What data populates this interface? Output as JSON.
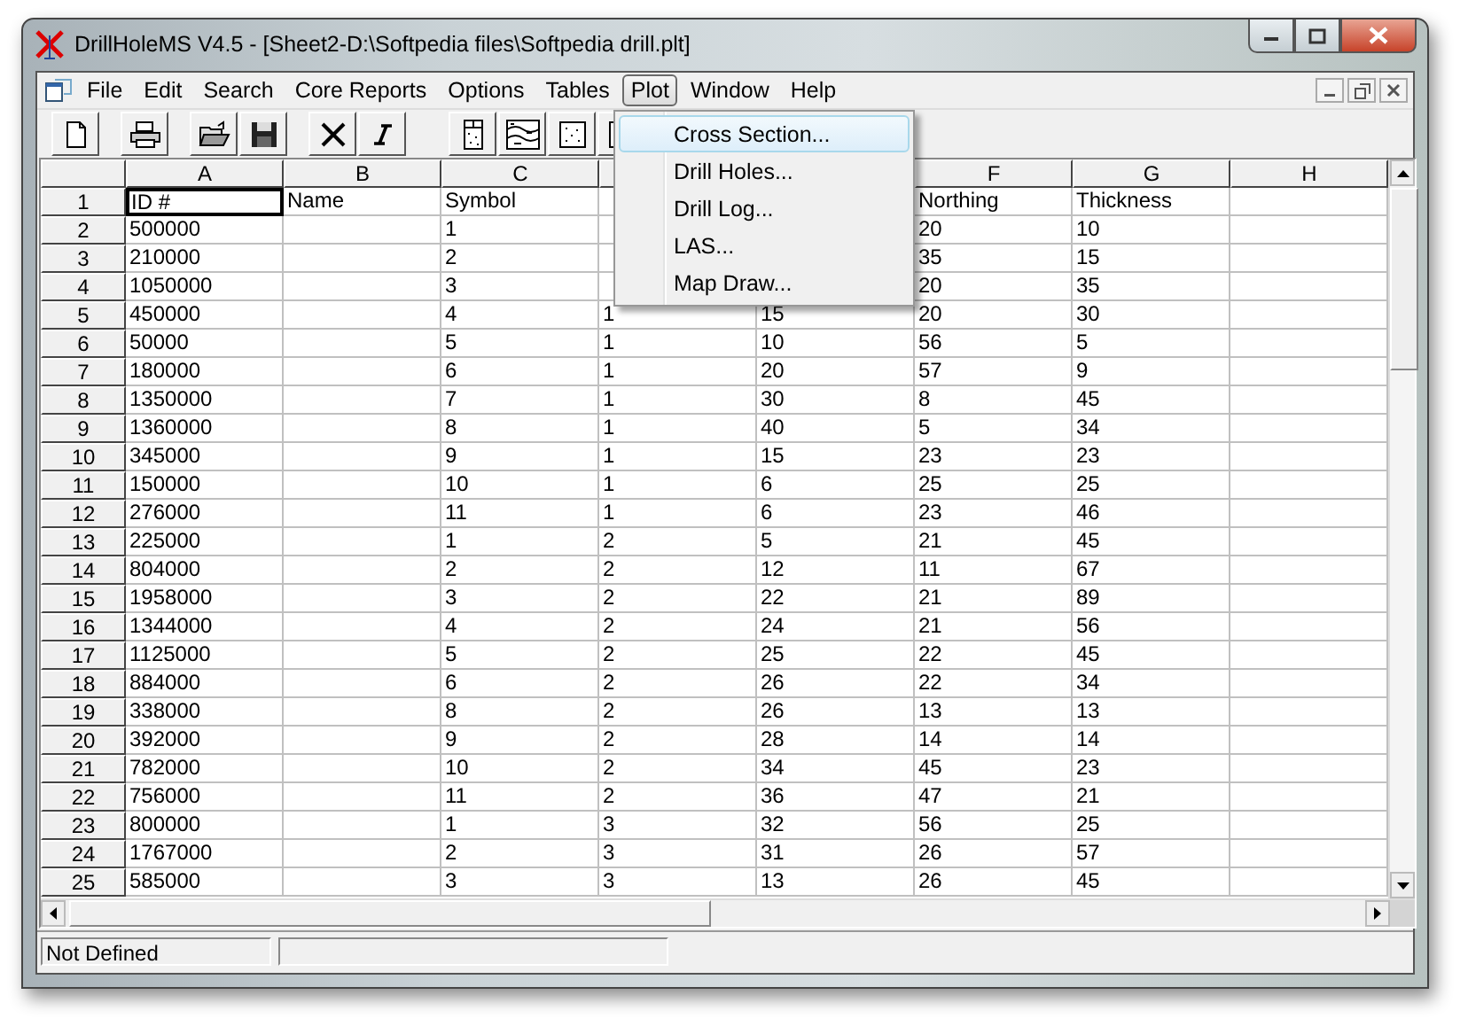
{
  "window": {
    "title": "DrillHoleMS V4.5 - [Sheet2-D:\\Softpedia files\\Softpedia drill.plt]"
  },
  "menu_bar": {
    "items": [
      {
        "label": "File",
        "selected": false
      },
      {
        "label": "Edit",
        "selected": false
      },
      {
        "label": "Search",
        "selected": false
      },
      {
        "label": "Core Reports",
        "selected": false
      },
      {
        "label": "Options",
        "selected": false
      },
      {
        "label": "Tables",
        "selected": false
      },
      {
        "label": "Plot",
        "selected": true
      },
      {
        "label": "Window",
        "selected": false
      },
      {
        "label": "Help",
        "selected": false
      }
    ]
  },
  "plot_menu": {
    "items": [
      {
        "label": "Cross Section...",
        "selected": true
      },
      {
        "label": "Drill Holes...",
        "selected": false
      },
      {
        "label": "Drill Log...",
        "selected": false
      },
      {
        "label": "LAS...",
        "selected": false
      },
      {
        "label": "Map Draw...",
        "selected": false
      }
    ]
  },
  "sheet": {
    "columns": [
      "A",
      "B",
      "C",
      null,
      null,
      "F",
      "G",
      "H"
    ],
    "rows": [
      {
        "number": "1",
        "selected": true,
        "cells": [
          "ID #",
          "Name",
          "Symbol",
          null,
          null,
          "Northing",
          "Thickness",
          null
        ]
      },
      {
        "number": "2",
        "selected": false,
        "cells": [
          "500000",
          null,
          "1",
          null,
          null,
          "20",
          "10",
          null
        ]
      },
      {
        "number": "3",
        "selected": false,
        "cells": [
          "210000",
          null,
          "2",
          null,
          null,
          "35",
          "15",
          null
        ]
      },
      {
        "number": "4",
        "selected": false,
        "cells": [
          "1050000",
          null,
          "3",
          null,
          null,
          "20",
          "35",
          null
        ]
      },
      {
        "number": "5",
        "selected": false,
        "cells": [
          "450000",
          null,
          "4",
          "1",
          "15",
          "20",
          "30",
          null
        ]
      },
      {
        "number": "6",
        "selected": false,
        "cells": [
          "50000",
          null,
          "5",
          "1",
          "10",
          "56",
          "5",
          null
        ]
      },
      {
        "number": "7",
        "selected": false,
        "cells": [
          "180000",
          null,
          "6",
          "1",
          "20",
          "57",
          "9",
          null
        ]
      },
      {
        "number": "8",
        "selected": false,
        "cells": [
          "1350000",
          null,
          "7",
          "1",
          "30",
          "8",
          "45",
          null
        ]
      },
      {
        "number": "9",
        "selected": false,
        "cells": [
          "1360000",
          null,
          "8",
          "1",
          "40",
          "5",
          "34",
          null
        ]
      },
      {
        "number": "10",
        "selected": false,
        "cells": [
          "345000",
          null,
          "9",
          "1",
          "15",
          "23",
          "23",
          null
        ]
      },
      {
        "number": "11",
        "selected": false,
        "cells": [
          "150000",
          null,
          "10",
          "1",
          "6",
          "25",
          "25",
          null
        ]
      },
      {
        "number": "12",
        "selected": false,
        "cells": [
          "276000",
          null,
          "11",
          "1",
          "6",
          "23",
          "46",
          null
        ]
      },
      {
        "number": "13",
        "selected": false,
        "cells": [
          "225000",
          null,
          "1",
          "2",
          "5",
          "21",
          "45",
          null
        ]
      },
      {
        "number": "14",
        "selected": false,
        "cells": [
          "804000",
          null,
          "2",
          "2",
          "12",
          "11",
          "67",
          null
        ]
      },
      {
        "number": "15",
        "selected": false,
        "cells": [
          "1958000",
          null,
          "3",
          "2",
          "22",
          "21",
          "89",
          null
        ]
      },
      {
        "number": "16",
        "selected": false,
        "cells": [
          "1344000",
          null,
          "4",
          "2",
          "24",
          "21",
          "56",
          null
        ]
      },
      {
        "number": "17",
        "selected": false,
        "cells": [
          "1125000",
          null,
          "5",
          "2",
          "25",
          "22",
          "45",
          null
        ]
      },
      {
        "number": "18",
        "selected": false,
        "cells": [
          "884000",
          null,
          "6",
          "2",
          "26",
          "22",
          "34",
          null
        ]
      },
      {
        "number": "19",
        "selected": false,
        "cells": [
          "338000",
          null,
          "8",
          "2",
          "26",
          "13",
          "13",
          null
        ]
      },
      {
        "number": "20",
        "selected": false,
        "cells": [
          "392000",
          null,
          "9",
          "2",
          "28",
          "14",
          "14",
          null
        ]
      },
      {
        "number": "21",
        "selected": false,
        "cells": [
          "782000",
          null,
          "10",
          "2",
          "34",
          "45",
          "23",
          null
        ]
      },
      {
        "number": "22",
        "selected": false,
        "cells": [
          "756000",
          null,
          "11",
          "2",
          "36",
          "47",
          "21",
          null
        ]
      },
      {
        "number": "23",
        "selected": false,
        "cells": [
          "800000",
          null,
          "1",
          "3",
          "32",
          "56",
          "25",
          null
        ]
      },
      {
        "number": "24",
        "selected": false,
        "cells": [
          "1767000",
          null,
          "2",
          "3",
          "31",
          "26",
          "57",
          null
        ]
      },
      {
        "number": "25",
        "selected": false,
        "cells": [
          "585000",
          null,
          "3",
          "3",
          "13",
          "26",
          "45",
          null
        ]
      }
    ]
  },
  "status_bar": {
    "panels": [
      "Not Defined"
    ]
  }
}
